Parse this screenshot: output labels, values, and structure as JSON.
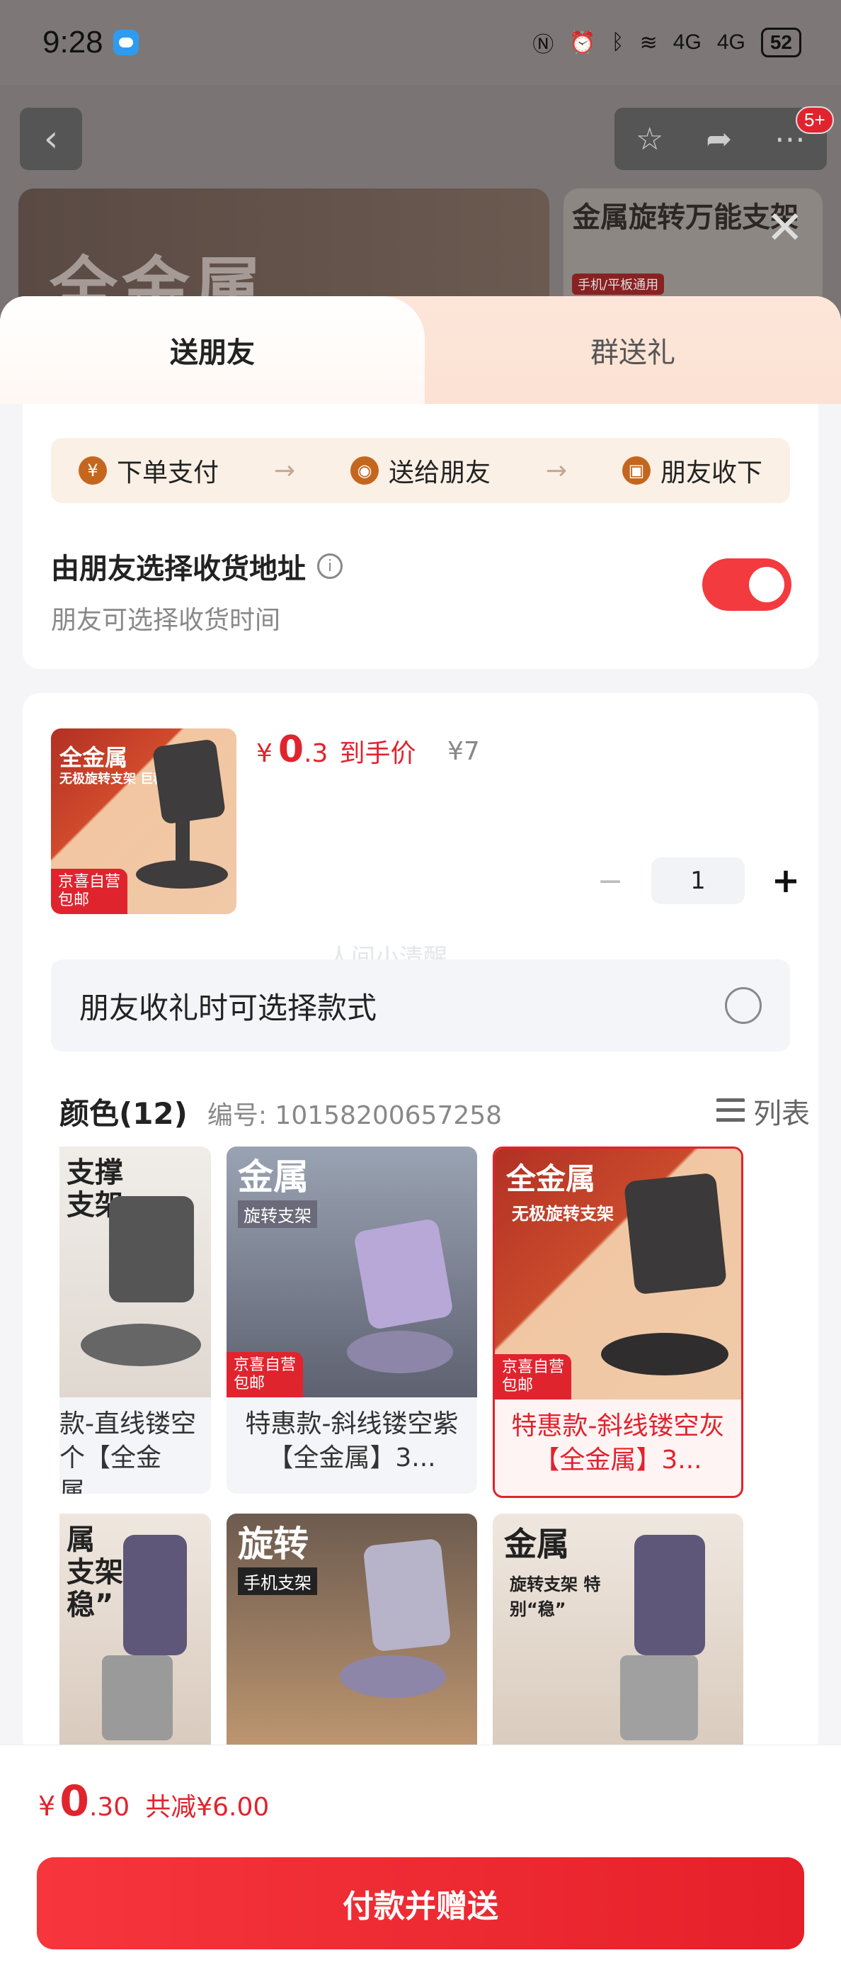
{
  "status_bar": {
    "time": "9:28",
    "network1": "4G",
    "network2": "4G",
    "battery": "52"
  },
  "background": {
    "badge": "5+",
    "banner1_text": "全金属",
    "banner2_text": "金属旋转万能支架",
    "banner2_tag": "手机/平板通用"
  },
  "tabs": [
    {
      "label": "送朋友",
      "active": true
    },
    {
      "label": "群送礼",
      "active": false
    }
  ],
  "flow": {
    "steps": [
      "下单支付",
      "送给朋友",
      "朋友收下"
    ],
    "arrow": "→"
  },
  "address": {
    "title": "由朋友选择收货地址",
    "subtitle": "朋友可选择收货时间",
    "toggle_on": true
  },
  "product": {
    "thumb_title": "全金属",
    "thumb_sub": "无极旋转支架 巨稳!",
    "thumb_badge_line1": "京喜自营",
    "thumb_badge_line2": "包邮",
    "price_symbol": "¥",
    "price_int": "0",
    "price_dec": ".3",
    "price_label": "到手价",
    "original_price": "¥7",
    "quantity": "1",
    "minus": "−",
    "plus": "+"
  },
  "watermark": "人间小清醒",
  "style_option": {
    "label": "朋友收礼时可选择款式",
    "checked": false
  },
  "colors": {
    "title": "颜色(12)",
    "code": "编号: 10158200657258",
    "view_label": "列表",
    "items": [
      {
        "label": "款-直线镂空 个【全金属...",
        "img_text": "支撑\n支架",
        "selected": false
      },
      {
        "label": "特惠款-斜线镂空紫【全金属】3...",
        "img_text": "金属",
        "img_sub": "旋转支架",
        "selected": false
      },
      {
        "label": "特惠款-斜线镂空灰【全金属】3...",
        "img_text": "全金属",
        "img_sub": "无极旋转支架",
        "selected": true
      },
      {
        "label": "",
        "img_text": "属\n支架\n稳”",
        "selected": false
      },
      {
        "label": "",
        "img_text": "旋转",
        "img_sub": "手机支架",
        "selected": false
      },
      {
        "label": "",
        "img_text": "金属",
        "img_sub": "旋转支架 特别“稳”",
        "selected": false
      }
    ]
  },
  "bottom": {
    "currency": "¥",
    "total_int": "0",
    "total_dec": ".30",
    "saved": "共减¥6.00",
    "pay_button": "付款并赠送"
  },
  "colors_theme": {
    "accent": "#e0242e",
    "toggle": "#f33a3e",
    "tab_bg": "#fbe2d3"
  }
}
